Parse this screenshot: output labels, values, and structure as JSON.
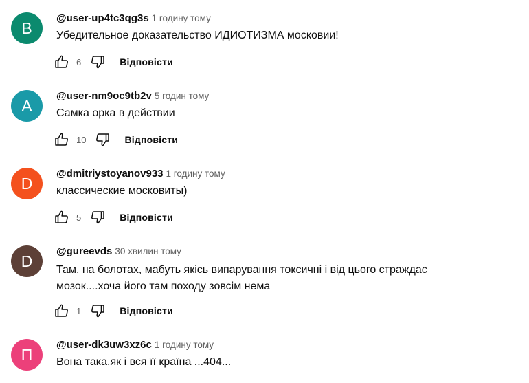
{
  "reply_label": "Відповісти",
  "comments": [
    {
      "avatar_letter": "B",
      "avatar_color": "#0b8a6e",
      "author": "@user-up4tc3qg3s",
      "time": "1 годину тому",
      "text": "Убедительное доказательство ИДИОТИЗМА московии!",
      "likes": "6"
    },
    {
      "avatar_letter": "A",
      "avatar_color": "#1a9aa8",
      "author": "@user-nm9oc9tb2v",
      "time": "5 годин тому",
      "text": "Самка орка в действии",
      "likes": "10"
    },
    {
      "avatar_letter": "D",
      "avatar_color": "#f4511e",
      "author": "@dmitriystoyanov933",
      "time": "1 годину тому",
      "text": "классические московиты)",
      "likes": "5"
    },
    {
      "avatar_letter": "D",
      "avatar_color": "#5d4037",
      "author": "@gureevds",
      "time": "30 хвилин тому",
      "text": "Там, на болотах, мабуть якісь випарування токсичні і від цього страждає мозок....хоча його там походу зовсім нема",
      "likes": "1"
    },
    {
      "avatar_letter": "П",
      "avatar_color": "#ec407a",
      "author": "@user-dk3uw3xz6c",
      "time": "1 годину тому",
      "text": "Вона така,як і вся її країна ...404...",
      "likes": ""
    }
  ],
  "icons": {
    "like": "thumbs-up-icon",
    "dislike": "thumbs-down-icon"
  }
}
